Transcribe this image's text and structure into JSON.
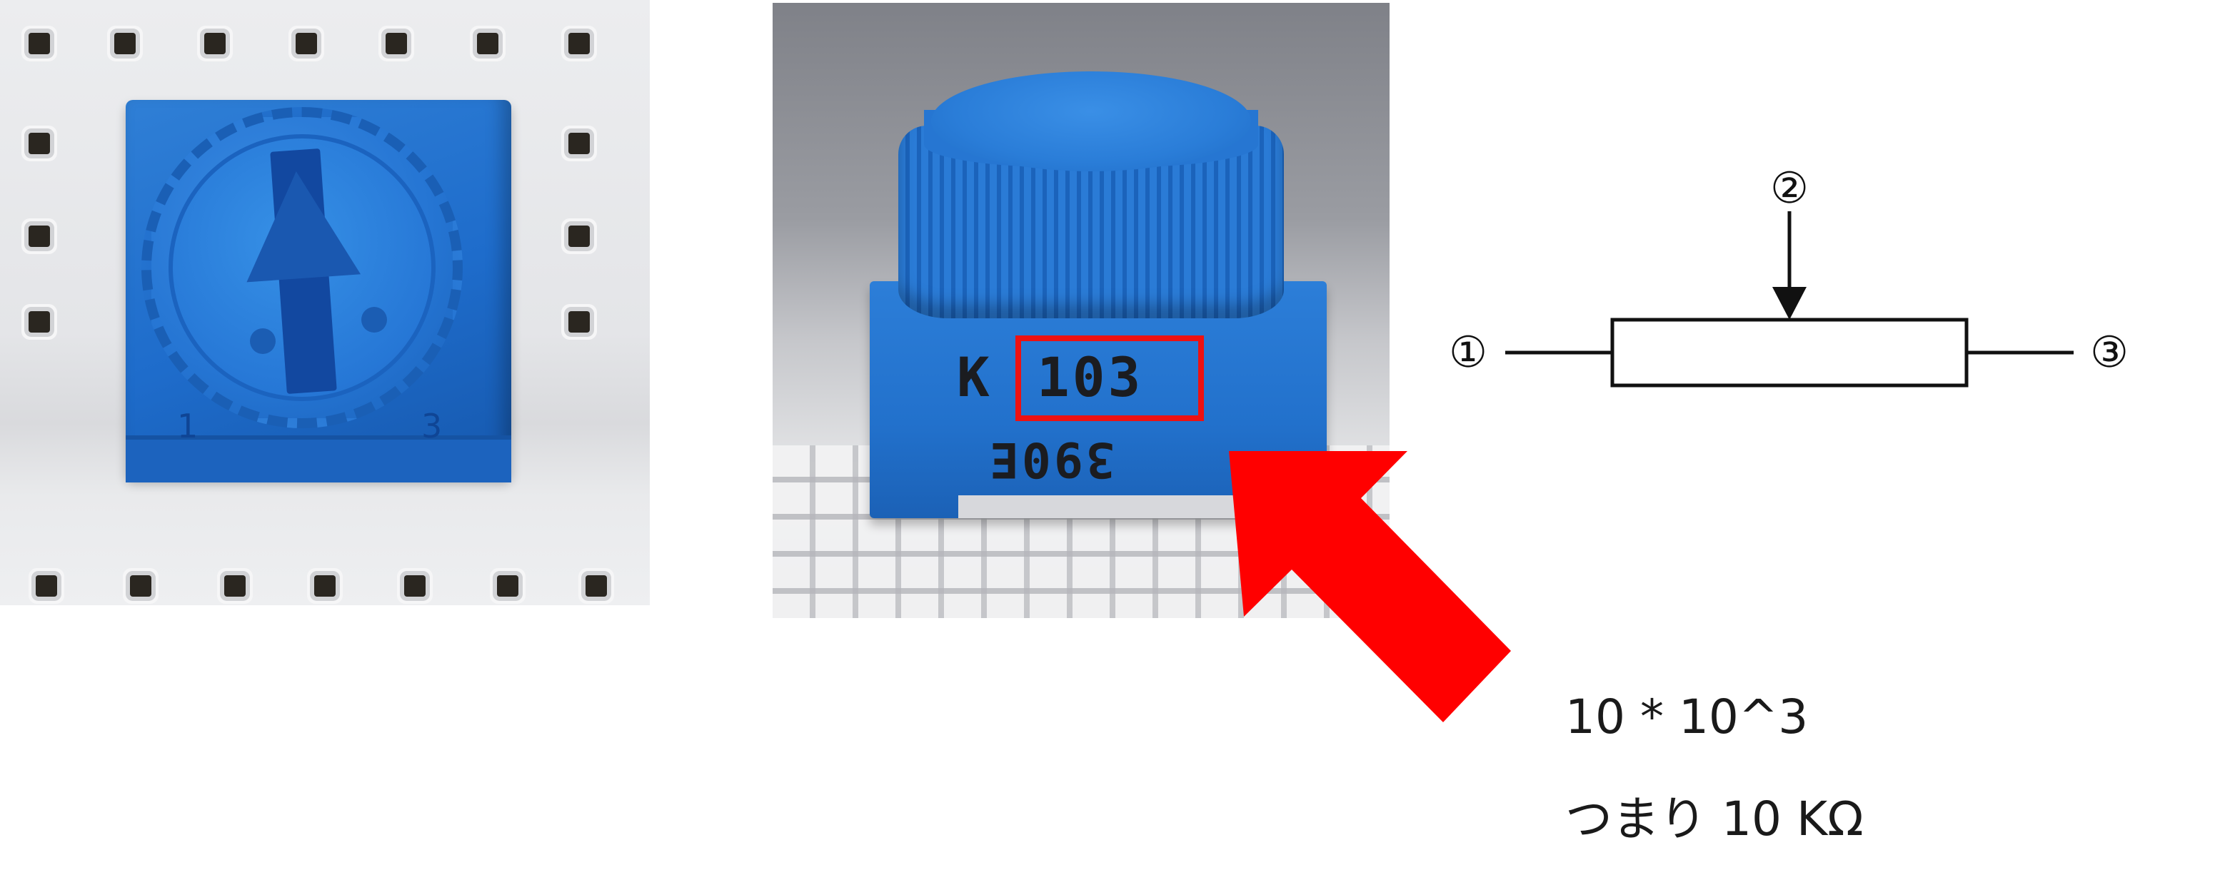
{
  "photo_top": {
    "pin_labels": [
      "1",
      "3"
    ]
  },
  "photo_side": {
    "prefix_mark": "K",
    "value_code": "103",
    "lot_code": "390E",
    "highlight_color": "#ee1111"
  },
  "schematic": {
    "terminal_1": "①",
    "terminal_2": "②",
    "terminal_3": "③"
  },
  "annotation": {
    "line1": "10 * 10^3",
    "line2": "つまり 10 KΩ"
  },
  "colors": {
    "pot_blue": "#2271cc",
    "arrow_red": "#ff0000"
  }
}
